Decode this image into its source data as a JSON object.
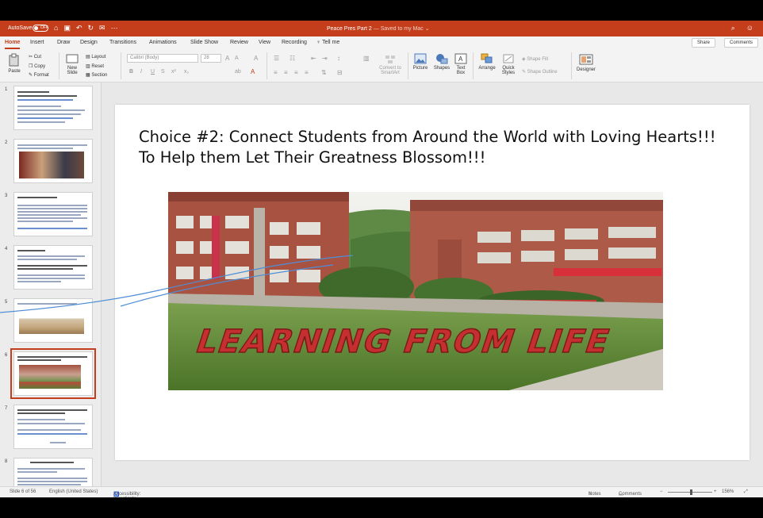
{
  "window": {
    "autosave_label": "AutoSave",
    "autosave_state": "OFF",
    "doc_title": "Peace Pres Part 2",
    "doc_status": "— Saved to my Mac ⌄"
  },
  "tabs": [
    "Home",
    "Insert",
    "Draw",
    "Design",
    "Transitions",
    "Animations",
    "Slide Show",
    "Review",
    "View",
    "Recording"
  ],
  "tell_me": "Tell me",
  "share_label": "Share",
  "comments_label": "Comments",
  "ribbon": {
    "paste": "Paste",
    "cut": "Cut",
    "copy": "Copy",
    "format": "Format",
    "new_slide": "New Slide",
    "layout": "Layout",
    "reset": "Reset",
    "section": "Section",
    "font_name": "Calibri (Body)",
    "font_size": "28",
    "convert_smartart": "Convert to SmartArt",
    "picture": "Picture",
    "shapes": "Shapes",
    "text_box": "Text Box",
    "arrange": "Arrange",
    "quick_styles": "Quick Styles",
    "shape_fill": "Shape Fill",
    "shape_outline": "Shape Outline",
    "designer": "Designer"
  },
  "thumbnails": [
    {
      "num": "1"
    },
    {
      "num": "2"
    },
    {
      "num": "3"
    },
    {
      "num": "4"
    },
    {
      "num": "5"
    },
    {
      "num": "6"
    },
    {
      "num": "7"
    },
    {
      "num": "8"
    }
  ],
  "slide": {
    "title_line1": "Choice #2: Connect Students from Around the World with Loving Hearts!!!",
    "title_line2": "To Help them Let Their Greatness Blossom!!!",
    "photo_sign_text": "LEARNING FROM LIFE"
  },
  "status": {
    "slide_count": "Slide 6 of 56",
    "language": "English (United States)",
    "accessibility": "Accessibility: Investigate",
    "notes": "Notes",
    "comments": "Comments",
    "zoom": "156%"
  },
  "colors": {
    "accent": "#c43e1c"
  }
}
